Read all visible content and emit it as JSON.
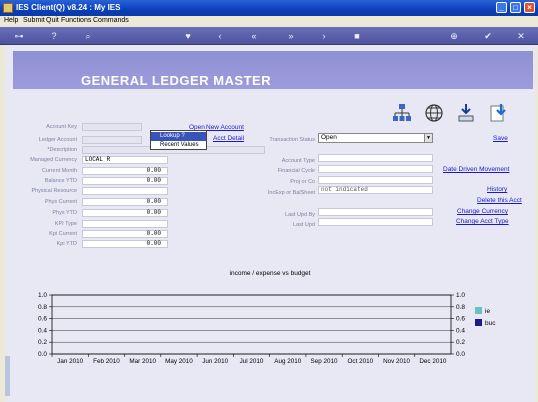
{
  "window": {
    "title": "IES Client(Q) v8.24 : My IES"
  },
  "menu": [
    "Help",
    "Submit",
    "Quit",
    "Functions",
    "Commands"
  ],
  "toolbar": {
    "icons": [
      "key-icon",
      "help-icon",
      "search-icon",
      "heart-icon",
      "back-icon",
      "rewind-icon",
      "fast-forward-icon",
      "forward-icon",
      "upload-icon",
      "stop-icon",
      "add-icon",
      "ok-icon",
      "close-icon"
    ]
  },
  "page": {
    "title": "GENERAL LEDGER MASTER"
  },
  "left_form": {
    "account_key": {
      "label": "Account Key",
      "value": ""
    },
    "ledger_account": {
      "label": "Ledger Account",
      "value": ""
    },
    "description": {
      "label": "*Description",
      "value": ""
    },
    "managed_currency": {
      "label": "Managed Currency",
      "value": "LOCAL R"
    },
    "current_month": {
      "label": "Current Month",
      "value": "0.00"
    },
    "balance_ytd": {
      "label": "Balance YTD",
      "value": "0.00"
    },
    "physical_resource": {
      "label": "Physical Resource",
      "value": ""
    },
    "phys_current": {
      "label": "Phys Current",
      "value": "0.00"
    },
    "phys_ytd": {
      "label": "Phys YTD",
      "value": "0.00"
    },
    "kpi_type": {
      "label": "KPI Type",
      "value": ""
    },
    "kpi_current": {
      "label": "Kpi Current",
      "value": "0.00"
    },
    "kpi_ytd": {
      "label": "Kpi YTD",
      "value": "0.00"
    }
  },
  "mid_links": {
    "open": "Open",
    "new_account": "New Account",
    "acct_detail": "Acct Detail"
  },
  "popup": {
    "items": [
      "Lookup ?",
      "Recent Values"
    ],
    "selected": 0
  },
  "right_form": {
    "transaction_status": {
      "label": "Transaction Status",
      "value": "Open"
    },
    "account_type": {
      "label": "Account Type",
      "value": ""
    },
    "financial_cycle": {
      "label": "Financial Cycle",
      "value": ""
    },
    "proj_or_co": {
      "label": "Proj or Co",
      "value": ""
    },
    "inc_exp_or_balsheet": {
      "label": "IncExp or BalSheet",
      "value": "not indicated"
    },
    "last_upd_by": {
      "label": "Last Upd By",
      "value": ""
    },
    "last_upd": {
      "label": "Last Upd",
      "value": ""
    }
  },
  "right_links": {
    "save": "Save",
    "date_driven_movement": "Date Driven Movement",
    "history": "History",
    "delete_this_acct": "Delete this Acct",
    "change_currency": "Change Currency",
    "change_acct_type": "Change Acct Type"
  },
  "chart_data": {
    "type": "bar",
    "title": "income / expense vs budget",
    "categories": [
      "Jan 2010",
      "Feb 2010",
      "Mar 2010",
      "May 2010",
      "Jun 2010",
      "Jul 2010",
      "Aug 2010",
      "Sep 2010",
      "Oct 2010",
      "Nov 2010",
      "Dec 2010"
    ],
    "series": [
      {
        "name": "ie",
        "color": "#66c2c2",
        "values": [
          0,
          0,
          0,
          0,
          0,
          0,
          0,
          0,
          0,
          0,
          0
        ]
      },
      {
        "name": "buc",
        "color": "#1a1a8c",
        "values": [
          0,
          0,
          0,
          0,
          0,
          0,
          0,
          0,
          0,
          0,
          0
        ]
      }
    ],
    "ylim": [
      0,
      1
    ],
    "yticks": [
      "0.0",
      "0.2",
      "0.4",
      "0.6",
      "0.8",
      "1.0"
    ],
    "grid": true,
    "legend": "right"
  }
}
